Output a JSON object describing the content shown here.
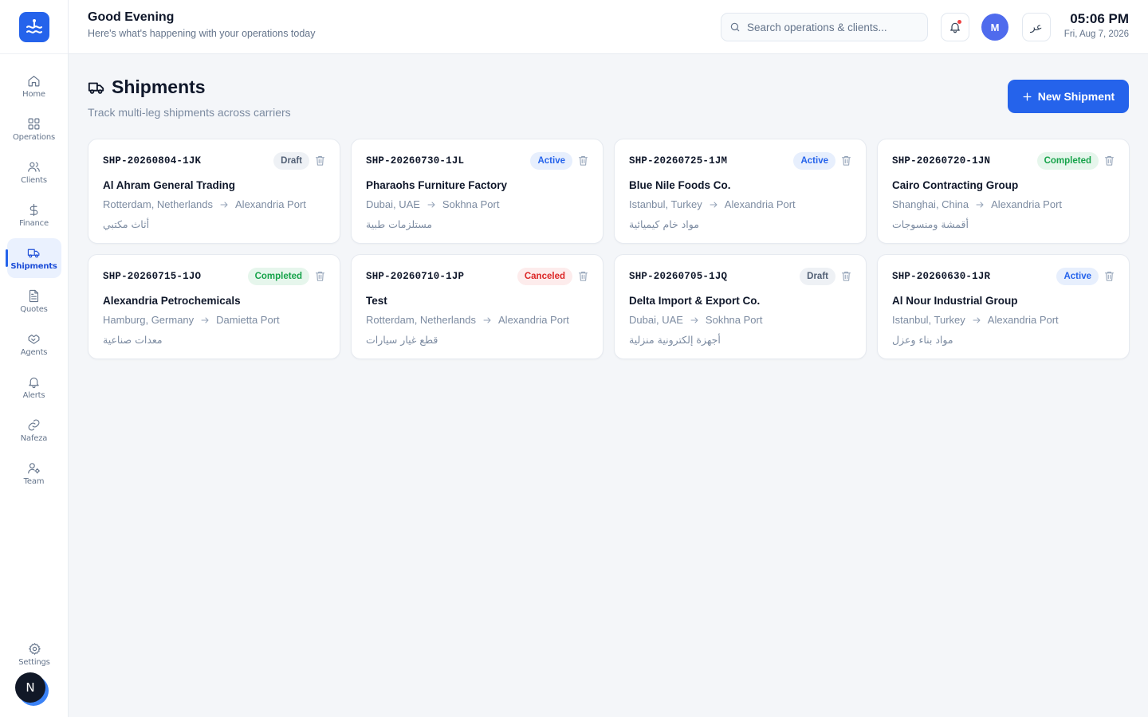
{
  "sidebar": {
    "items": [
      {
        "label": "Home",
        "icon": "home-icon",
        "active": false
      },
      {
        "label": "Operations",
        "icon": "grid-icon",
        "active": false
      },
      {
        "label": "Clients",
        "icon": "users-icon",
        "active": false
      },
      {
        "label": "Finance",
        "icon": "dollar-icon",
        "active": false
      },
      {
        "label": "Shipments",
        "icon": "truck-icon",
        "active": true
      },
      {
        "label": "Quotes",
        "icon": "document-icon",
        "active": false
      },
      {
        "label": "Agents",
        "icon": "handshake-icon",
        "active": false
      },
      {
        "label": "Alerts",
        "icon": "bell-icon",
        "active": false
      },
      {
        "label": "Nafeza",
        "icon": "link-icon",
        "active": false
      },
      {
        "label": "Team",
        "icon": "user-cog-icon",
        "active": false
      }
    ],
    "settings_label": "Settings",
    "bottom_avatar": "N"
  },
  "header": {
    "greeting": "Good Evening",
    "subtitle": "Here's what's happening with your operations today",
    "search_placeholder": "Search operations & clients...",
    "user_initial": "M",
    "lang_toggle": "عر",
    "time": "05:06 PM",
    "date": "Fri, Aug 7, 2026"
  },
  "page": {
    "title": "Shipments",
    "subtitle": "Track multi-leg shipments across carriers",
    "new_button": "New Shipment"
  },
  "shipments": [
    {
      "id": "SHP-20260804-1JK",
      "status": "Draft",
      "client": "Al Ahram General Trading",
      "origin": "Rotterdam, Netherlands",
      "destination": "Alexandria Port",
      "cargo": "أثاث مكتبي"
    },
    {
      "id": "SHP-20260730-1JL",
      "status": "Active",
      "client": "Pharaohs Furniture Factory",
      "origin": "Dubai, UAE",
      "destination": "Sokhna Port",
      "cargo": "مستلزمات طبية"
    },
    {
      "id": "SHP-20260725-1JM",
      "status": "Active",
      "client": "Blue Nile Foods Co.",
      "origin": "Istanbul, Turkey",
      "destination": "Alexandria Port",
      "cargo": "مواد خام كيميائية"
    },
    {
      "id": "SHP-20260720-1JN",
      "status": "Completed",
      "client": "Cairo Contracting Group",
      "origin": "Shanghai, China",
      "destination": "Alexandria Port",
      "cargo": "أقمشة ومنسوجات"
    },
    {
      "id": "SHP-20260715-1JO",
      "status": "Completed",
      "client": "Alexandria Petrochemicals",
      "origin": "Hamburg, Germany",
      "destination": "Damietta Port",
      "cargo": "معدات صناعية"
    },
    {
      "id": "SHP-20260710-1JP",
      "status": "Canceled",
      "client": "Test",
      "origin": "Rotterdam, Netherlands",
      "destination": "Alexandria Port",
      "cargo": "قطع غيار سيارات"
    },
    {
      "id": "SHP-20260705-1JQ",
      "status": "Draft",
      "client": "Delta Import & Export Co.",
      "origin": "Dubai, UAE",
      "destination": "Sokhna Port",
      "cargo": "أجهزة إلكترونية منزلية"
    },
    {
      "id": "SHP-20260630-1JR",
      "status": "Active",
      "client": "Al Nour Industrial Group",
      "origin": "Istanbul, Turkey",
      "destination": "Alexandria Port",
      "cargo": "مواد بناء وعزل"
    }
  ],
  "colors": {
    "accent": "#2563eb",
    "draft": "#526075",
    "active": "#2563eb",
    "completed": "#16a34a",
    "canceled": "#dc2626"
  }
}
